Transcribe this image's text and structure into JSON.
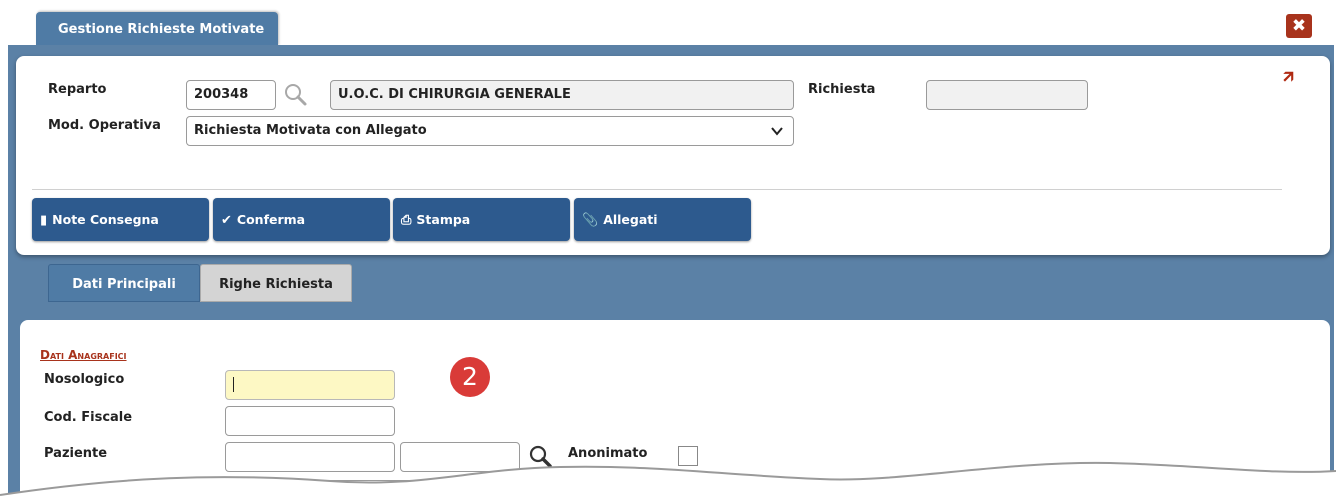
{
  "window": {
    "tab_title": "Gestione Richieste Motivate",
    "close_label": "✖"
  },
  "header": {
    "reparto_label": "Reparto",
    "reparto_code": "200348",
    "reparto_name": "U.O.C. DI CHIRURGIA GENERALE",
    "richiesta_label": "Richiesta",
    "richiesta_value": "",
    "mod_operativa_label": "Mod. Operativa",
    "mod_operativa_value": "Richiesta Motivata con Allegato"
  },
  "actions": [
    {
      "label": "Note Consegna",
      "icon": "note-icon"
    },
    {
      "label": "Conferma",
      "icon": "check-icon"
    },
    {
      "label": "Stampa",
      "icon": "print-icon"
    },
    {
      "label": "Allegati",
      "icon": "paperclip-icon"
    }
  ],
  "tabs": [
    {
      "label": "Dati Principali",
      "active": true
    },
    {
      "label": "Righe Richiesta",
      "active": false
    }
  ],
  "form": {
    "section_title": "Dati Anagrafici",
    "nosologico_label": "Nosologico",
    "nosologico_value": "",
    "cod_fiscale_label": "Cod. Fiscale",
    "paziente_label": "Paziente",
    "anonimato_label": "Anonimato"
  },
  "annotation": {
    "badge": "2"
  },
  "colors": {
    "accent": "#2d5a8e",
    "frame": "#5b81a6",
    "close": "#a8331c",
    "highlight": "#fdf8c4",
    "badge": "#d93b38"
  }
}
